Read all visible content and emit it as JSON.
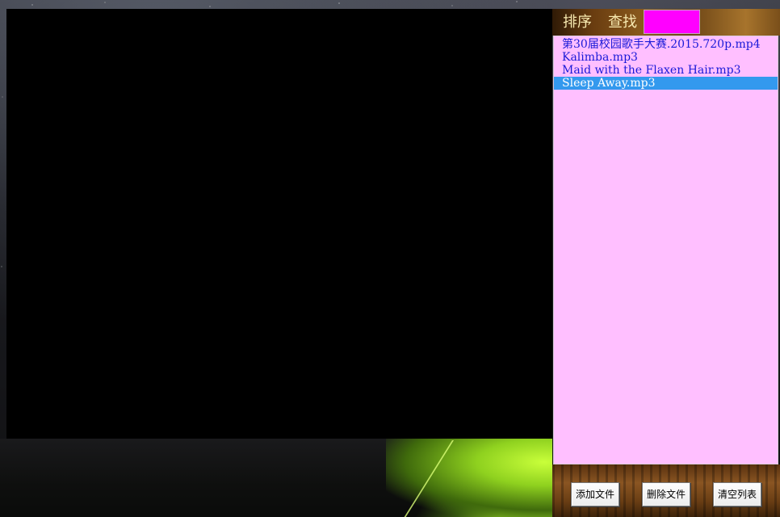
{
  "top_bar": {
    "sort_label": "排序",
    "find_label": "查找",
    "search_value": "",
    "search_color": "#ff00ff"
  },
  "playlist": {
    "items": [
      "第30届校园歌手大赛.2015.720p.mp4",
      "Kalimba.mp3",
      "Maid with the Flaxen Hair.mp3",
      "Sleep Away.mp3"
    ],
    "selected_index": 3,
    "background": "#ffbfff",
    "text_color": "#1a1ad8",
    "selected_color": "#3399ee"
  },
  "bottom_bar": {
    "add_label": "添加文件",
    "delete_label": "删除文件",
    "clear_label": "清空列表"
  }
}
